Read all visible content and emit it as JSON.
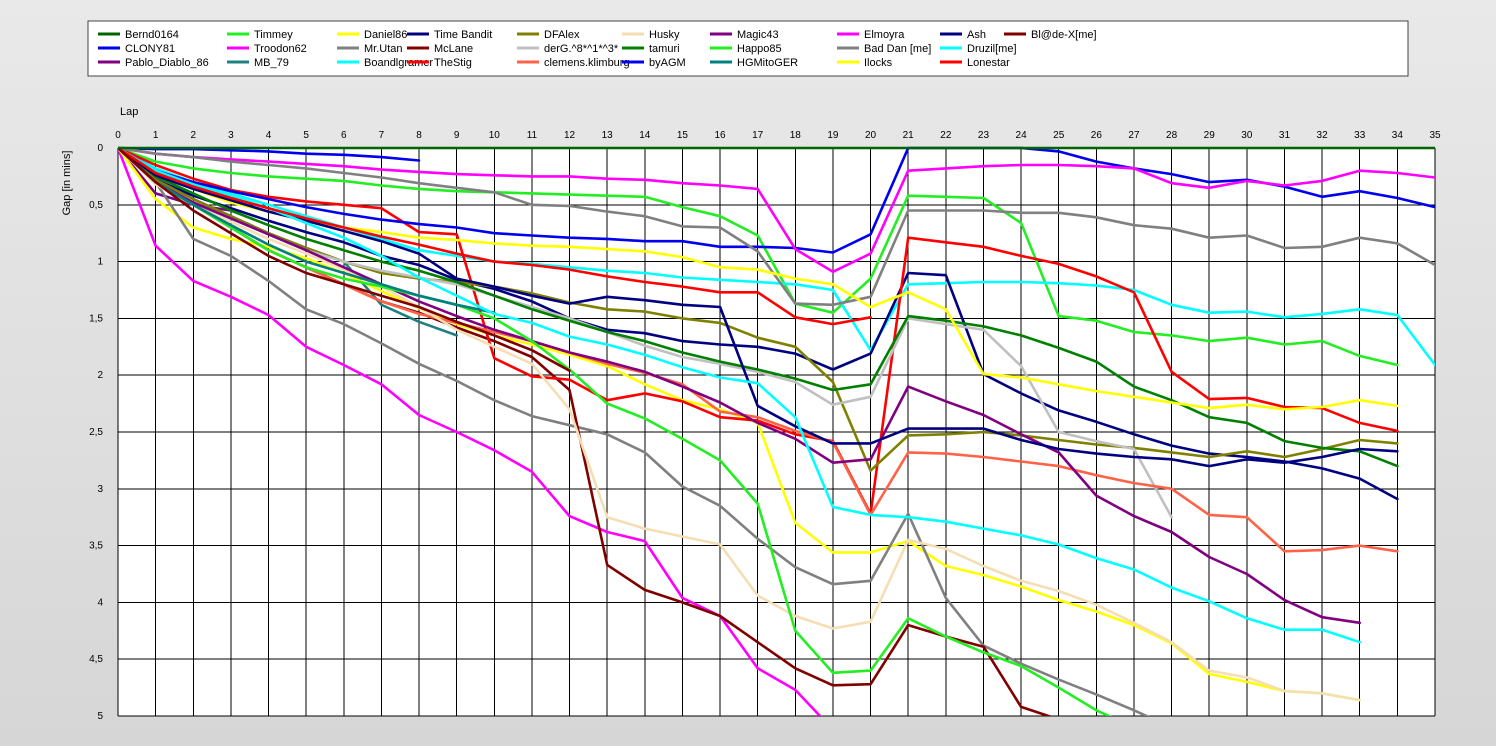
{
  "chart_data": {
    "type": "line",
    "xlabel": "Lap",
    "ylabel": "Gap [in mins]",
    "xlim": [
      0,
      35
    ],
    "ylim": [
      0,
      5
    ],
    "y_inverted": true,
    "grid": true,
    "legend_position": "top",
    "x_ticks": [
      "0",
      "1",
      "2",
      "3",
      "4",
      "5",
      "6",
      "7",
      "8",
      "9",
      "10",
      "11",
      "12",
      "13",
      "14",
      "15",
      "16",
      "17",
      "18",
      "19",
      "20",
      "21",
      "22",
      "23",
      "24",
      "25",
      "26",
      "27",
      "28",
      "29",
      "30",
      "31",
      "32",
      "33",
      "34",
      "35"
    ],
    "y_ticks": [
      "0",
      "0,5",
      "1",
      "1,5",
      "2",
      "2,5",
      "3",
      "3,5",
      "4",
      "4,5",
      "5"
    ],
    "series": [
      {
        "name": "Bernd0164",
        "color": "#006400",
        "values": [
          0,
          0,
          0,
          0,
          0,
          0,
          0,
          0,
          0,
          0,
          0,
          0,
          0,
          0,
          0,
          0,
          0,
          0,
          0,
          0,
          0,
          0,
          0,
          0,
          0,
          0,
          0,
          0,
          0,
          0,
          0,
          0,
          0,
          0,
          0,
          0
        ]
      },
      {
        "name": "CLONY81",
        "color": "#0000ee",
        "values": [
          0,
          0.01,
          0.01,
          0.02,
          0.03,
          0.05,
          0.06,
          0.08,
          0.11
        ]
      },
      {
        "name": "Pablo_Diablo_86",
        "color": "#800080",
        "values": [
          0,
          0.4,
          0.5,
          0.55
        ]
      },
      {
        "name": "Timmey",
        "color": "#22ee22",
        "values": [
          0,
          0.12,
          0.18,
          0.22,
          0.25,
          0.27,
          0.29,
          0.33,
          0.36,
          0.38,
          0.39,
          0.4,
          0.41,
          0.42,
          0.43,
          0.52,
          0.6,
          0.77,
          1.37,
          1.45,
          1.15,
          0.42,
          0.43,
          0.44,
          0.66,
          1.48,
          1.52,
          1.62,
          1.65,
          1.7,
          1.67,
          1.73,
          1.7,
          1.83,
          1.91
        ]
      },
      {
        "name": "Troodon62",
        "color": "#ff00ff",
        "values": [
          0,
          0.86,
          1.17,
          1.31,
          1.47,
          1.75,
          1.91,
          2.08,
          2.35,
          2.5,
          2.66,
          2.85,
          3.24,
          3.38,
          3.46,
          3.96,
          4.12,
          4.58,
          4.77,
          5.12
        ]
      },
      {
        "name": "MB_79",
        "color": "#208080",
        "values": [
          0,
          0.27,
          0.45,
          0.6,
          0.75,
          0.88,
          1.0,
          1.38,
          1.53,
          1.65
        ]
      },
      {
        "name": "Daniel86",
        "color": "#ffff00",
        "values": [
          0,
          0.45,
          0.7,
          0.8,
          0.87,
          0.97,
          1.1,
          1.26,
          1.41,
          1.55,
          1.65,
          1.73,
          1.82,
          1.92,
          2.08,
          2.22,
          2.3,
          2.42,
          3.3,
          3.56,
          3.56,
          3.46,
          3.68,
          3.76,
          3.86,
          3.98,
          4.08,
          4.2,
          4.36,
          4.63,
          4.7,
          4.78,
          4.8,
          4.86
        ]
      },
      {
        "name": "Mr.Utan",
        "color": "#808080",
        "values": [
          0,
          0.3,
          0.8,
          0.95,
          1.17,
          1.42,
          1.55,
          1.72,
          1.9,
          2.05,
          2.22,
          2.36,
          2.44,
          2.52,
          2.68,
          2.98,
          3.15,
          3.44,
          3.69,
          3.84,
          3.81,
          3.22,
          3.96,
          4.38,
          4.54,
          4.68,
          4.81,
          4.95,
          5.1
        ]
      },
      {
        "name": "Boandlgramer",
        "color": "#00ffff",
        "values": [
          0,
          0.18,
          0.3,
          0.4,
          0.5,
          0.6,
          0.7,
          0.8,
          0.9,
          0.95,
          1.0,
          1.02,
          1.05,
          1.08,
          1.1,
          1.14,
          1.16,
          1.18,
          1.2,
          1.25,
          1.78,
          1.2,
          1.19,
          1.18,
          1.18,
          1.19,
          1.21,
          1.25,
          1.38,
          1.45,
          1.44,
          1.49,
          1.46,
          1.42,
          1.47,
          1.91
        ]
      },
      {
        "name": "Time Bandit",
        "color": "#000080",
        "values": [
          0,
          0.28,
          0.42,
          0.53,
          0.64,
          0.74,
          0.83,
          0.95,
          1.03,
          1.16,
          1.24,
          1.35,
          1.5,
          1.6,
          1.63,
          1.7,
          1.73,
          1.75,
          1.81,
          1.95,
          1.81,
          1.1,
          1.12,
          1.99,
          2.16,
          2.31,
          2.41,
          2.52,
          2.62,
          2.69,
          2.72,
          2.76,
          2.82,
          2.91,
          3.09
        ]
      },
      {
        "name": "McLane",
        "color": "#800000",
        "values": [
          0,
          0.3,
          0.5,
          0.7,
          0.9,
          1.05,
          1.2,
          1.35,
          1.45,
          1.58,
          1.7,
          1.84,
          2.13,
          3.67,
          3.89,
          4.0,
          4.12,
          4.35,
          4.58,
          4.73,
          4.72,
          4.2,
          4.3,
          4.39,
          4.92,
          5.03
        ]
      },
      {
        "name": "TheStig",
        "color": "#ff0000",
        "values": [
          0,
          0.15,
          0.27,
          0.37,
          0.43,
          0.47,
          0.5,
          0.53,
          0.74,
          0.76,
          1.85,
          2.01,
          2.04,
          2.22,
          2.16,
          2.23,
          2.37,
          2.4,
          2.52,
          2.58,
          3.22,
          0.79,
          0.83,
          0.87,
          0.95,
          1.02,
          1.13,
          1.27,
          1.97,
          2.21,
          2.2,
          2.28,
          2.29,
          2.42,
          2.49
        ]
      },
      {
        "name": "DFAlex",
        "color": "#808000",
        "values": [
          0,
          0.28,
          0.45,
          0.6,
          0.75,
          0.88,
          1.0,
          1.1,
          1.15,
          1.18,
          1.22,
          1.28,
          1.36,
          1.42,
          1.44,
          1.5,
          1.54,
          1.67,
          1.75,
          2.06,
          2.84,
          2.53,
          2.52,
          2.5,
          2.53,
          2.57,
          2.61,
          2.64,
          2.68,
          2.72,
          2.67,
          2.72,
          2.65,
          2.57,
          2.6
        ]
      },
      {
        "name": "derG.^8*^1*^3*",
        "color": "#c0c0c0",
        "values": [
          0,
          0.3,
          0.48,
          0.62,
          0.76,
          0.9,
          1.0,
          1.08,
          1.14,
          1.2,
          1.3,
          1.4,
          1.5,
          1.62,
          1.74,
          1.84,
          1.9,
          1.97,
          2.06,
          2.26,
          2.19,
          1.5,
          1.55,
          1.6,
          1.92,
          2.5,
          2.58,
          2.65,
          3.25
        ]
      },
      {
        "name": "clemens.klimburg",
        "color": "#ff6347",
        "values": [
          0,
          0.3,
          0.5,
          0.7,
          0.9,
          1.05,
          1.2,
          1.35,
          1.46,
          1.54,
          1.62,
          1.7,
          1.8,
          1.9,
          1.98,
          2.08,
          2.32,
          2.37,
          2.49,
          2.59,
          3.23,
          2.68,
          2.69,
          2.72,
          2.76,
          2.8,
          2.88,
          2.95,
          3.0,
          3.23,
          3.25,
          3.55,
          3.54,
          3.5,
          3.55
        ]
      },
      {
        "name": "Husky",
        "color": "#f5deb3",
        "values": [
          0,
          0.32,
          0.5,
          0.65,
          0.8,
          0.93,
          1.07,
          1.22,
          1.4,
          1.6,
          1.75,
          1.9,
          2.3,
          3.25,
          3.35,
          3.42,
          3.49,
          3.94,
          4.12,
          4.23,
          4.17,
          3.45,
          3.53,
          3.68,
          3.81,
          3.9,
          4.02,
          4.18,
          4.35,
          4.6,
          4.66,
          4.78,
          4.8,
          4.86
        ]
      },
      {
        "name": "tamuri",
        "color": "#008000",
        "values": [
          0,
          0.25,
          0.4,
          0.55,
          0.68,
          0.8,
          0.9,
          1.0,
          1.08,
          1.18,
          1.3,
          1.42,
          1.52,
          1.62,
          1.7,
          1.8,
          1.88,
          1.95,
          2.03,
          2.13,
          2.08,
          1.48,
          1.52,
          1.57,
          1.65,
          1.76,
          1.88,
          2.1,
          2.22,
          2.37,
          2.42,
          2.58,
          2.64,
          2.67,
          2.8
        ]
      },
      {
        "name": "byAGM",
        "color": "#0000ee",
        "values": [
          0,
          0.2,
          0.3,
          0.38,
          0.45,
          0.52,
          0.58,
          0.63,
          0.67,
          0.7,
          0.75,
          0.77,
          0.79,
          0.8,
          0.82,
          0.82,
          0.87,
          0.87,
          0.88,
          0.92,
          0.76,
          0.0,
          0.0,
          0.0,
          0.0,
          0.03,
          0.12,
          0.18,
          0.23,
          0.3,
          0.28,
          0.34,
          0.43,
          0.38,
          0.44,
          0.52
        ]
      },
      {
        "name": "Magic43",
        "color": "#800080",
        "values": [
          0,
          0.3,
          0.48,
          0.62,
          0.76,
          0.9,
          1.05,
          1.2,
          1.35,
          1.48,
          1.6,
          1.7,
          1.8,
          1.88,
          1.97,
          2.1,
          2.24,
          2.42,
          2.56,
          2.77,
          2.74,
          2.1,
          2.23,
          2.35,
          2.52,
          2.68,
          3.06,
          3.24,
          3.38,
          3.6,
          3.75,
          3.98,
          4.13,
          4.18
        ]
      },
      {
        "name": "Happo85",
        "color": "#22ee22",
        "values": [
          0,
          0.3,
          0.5,
          0.7,
          0.9,
          1.05,
          1.15,
          1.22,
          1.3,
          1.38,
          1.5,
          1.7,
          1.95,
          2.25,
          2.38,
          2.56,
          2.75,
          3.13,
          4.25,
          4.62,
          4.6,
          4.14,
          4.3,
          4.44,
          4.56,
          4.75,
          4.95,
          5.1
        ]
      },
      {
        "name": "HGMitoGER",
        "color": "#008080",
        "values": [
          0,
          0.3,
          0.5,
          0.68,
          0.85,
          1.0,
          1.1,
          1.2,
          1.3,
          1.38,
          1.45
        ]
      },
      {
        "name": "Elmoyra",
        "color": "#ff00ff",
        "values": [
          0,
          0.05,
          0.08,
          0.1,
          0.12,
          0.14,
          0.16,
          0.19,
          0.21,
          0.23,
          0.24,
          0.25,
          0.25,
          0.27,
          0.28,
          0.31,
          0.33,
          0.36,
          0.89,
          1.09,
          0.93,
          0.2,
          0.18,
          0.16,
          0.15,
          0.15,
          0.16,
          0.18,
          0.31,
          0.35,
          0.29,
          0.33,
          0.29,
          0.2,
          0.22,
          0.26
        ]
      },
      {
        "name": "Bad Dan [me]",
        "color": "#808080",
        "values": [
          0,
          0.05,
          0.08,
          0.12,
          0.15,
          0.18,
          0.22,
          0.26,
          0.31,
          0.35,
          0.39,
          0.5,
          0.51,
          0.56,
          0.6,
          0.69,
          0.7,
          0.91,
          1.37,
          1.38,
          1.31,
          0.55,
          0.55,
          0.55,
          0.57,
          0.57,
          0.61,
          0.68,
          0.71,
          0.79,
          0.77,
          0.88,
          0.87,
          0.79,
          0.84,
          1.03
        ]
      },
      {
        "name": "Ilocks",
        "color": "#ffff00",
        "values": [
          0,
          0.22,
          0.36,
          0.48,
          0.56,
          0.64,
          0.7,
          0.74,
          0.79,
          0.81,
          0.84,
          0.86,
          0.87,
          0.89,
          0.91,
          0.96,
          1.05,
          1.07,
          1.15,
          1.2,
          1.4,
          1.27,
          1.42,
          1.99,
          2.02,
          2.08,
          2.14,
          2.19,
          2.24,
          2.29,
          2.26,
          2.3,
          2.28,
          2.22,
          2.27
        ]
      },
      {
        "name": "Ash",
        "color": "#000080",
        "values": [
          0,
          0.24,
          0.36,
          0.46,
          0.56,
          0.64,
          0.73,
          0.82,
          0.93,
          1.15,
          1.22,
          1.3,
          1.37,
          1.31,
          1.34,
          1.38,
          1.4,
          2.27,
          2.45,
          2.6,
          2.6,
          2.47,
          2.47,
          2.47,
          2.57,
          2.65,
          2.69,
          2.72,
          2.74,
          2.8,
          2.74,
          2.77,
          2.72,
          2.65,
          2.67
        ]
      },
      {
        "name": "Druzil[me]",
        "color": "#00ffff",
        "values": [
          0,
          0.2,
          0.32,
          0.42,
          0.53,
          0.66,
          0.79,
          0.95,
          1.14,
          1.3,
          1.46,
          1.54,
          1.66,
          1.73,
          1.82,
          1.93,
          2.02,
          2.07,
          2.37,
          3.16,
          3.23,
          3.25,
          3.29,
          3.35,
          3.41,
          3.49,
          3.61,
          3.71,
          3.87,
          3.99,
          4.14,
          4.24,
          4.24,
          4.35
        ]
      },
      {
        "name": "Lonestar",
        "color": "#ff0000",
        "values": [
          0,
          0.22,
          0.34,
          0.44,
          0.53,
          0.62,
          0.7,
          0.78,
          0.85,
          0.93,
          1.0,
          1.03,
          1.07,
          1.13,
          1.18,
          1.22,
          1.27,
          1.27,
          1.49,
          1.55,
          1.49
        ]
      },
      {
        "name": "Bl@de-X[me]",
        "color": "#800000",
        "values": [
          0,
          0.3,
          0.55,
          0.75,
          0.95,
          1.1,
          1.2,
          1.3,
          1.4,
          1.53,
          1.65,
          1.78,
          1.96
        ]
      }
    ]
  }
}
